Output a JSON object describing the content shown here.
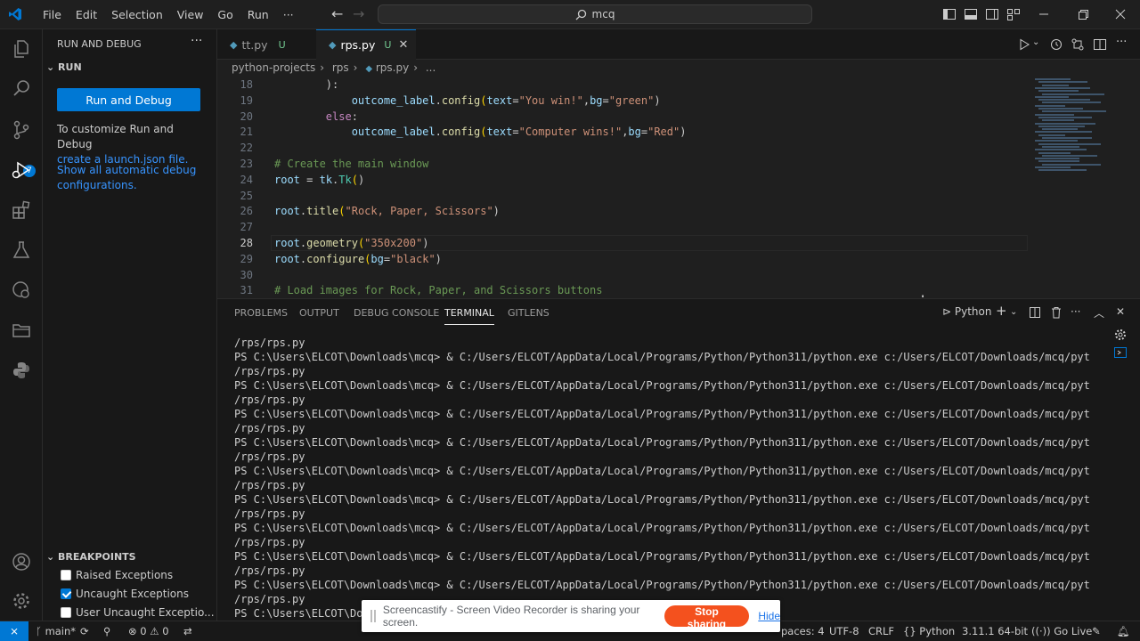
{
  "titlebar": {
    "menu": [
      "File",
      "Edit",
      "Selection",
      "View",
      "Go",
      "Run"
    ],
    "more": "···",
    "search": "mcq"
  },
  "sidebar": {
    "header": "RUN AND DEBUG",
    "section": "RUN",
    "run_button": "Run and Debug",
    "customize_text": "To customize Run and Debug",
    "customize_link": "create a launch.json file.",
    "show_link_1": "Show all automatic debug",
    "show_link_2": "configurations.",
    "breakpoints": {
      "header": "BREAKPOINTS",
      "items": [
        {
          "label": "Raised Exceptions",
          "checked": false
        },
        {
          "label": "Uncaught Exceptions",
          "checked": true
        },
        {
          "label": "User Uncaught Exceptio...",
          "checked": false
        }
      ]
    }
  },
  "tabs": [
    {
      "label": "tt.py",
      "status": "U"
    },
    {
      "label": "rps.py",
      "status": "U",
      "active": true
    }
  ],
  "breadcrumb": [
    "python-projects",
    "rps",
    "rps.py",
    "..."
  ],
  "code": {
    "lines": [
      {
        "n": "18",
        "text": "        ):"
      },
      {
        "n": "19",
        "text": "            outcome_label.config(text=\"You win!\",bg=\"green\")"
      },
      {
        "n": "20",
        "text": "        else:"
      },
      {
        "n": "21",
        "text": "            outcome_label.config(text=\"Computer wins!\",bg=\"Red\")"
      },
      {
        "n": "22",
        "text": ""
      },
      {
        "n": "23",
        "text": "# Create the main window"
      },
      {
        "n": "24",
        "text": "root = tk.Tk()"
      },
      {
        "n": "25",
        "text": ""
      },
      {
        "n": "26",
        "text": "root.title(\"Rock, Paper, Scissors\")"
      },
      {
        "n": "27",
        "text": ""
      },
      {
        "n": "28",
        "text": "root.geometry(\"350x200\")"
      },
      {
        "n": "29",
        "text": "root.configure(bg=\"black\")"
      },
      {
        "n": "30",
        "text": ""
      },
      {
        "n": "31",
        "text": "# Load images for Rock, Paper, and Scissors buttons"
      }
    ]
  },
  "panel": {
    "tabs": [
      "PROBLEMS",
      "OUTPUT",
      "DEBUG CONSOLE",
      "TERMINAL",
      "GITLENS"
    ],
    "active_tab": "TERMINAL",
    "shell": "Python",
    "terminal_lines": [
      "/rps/rps.py",
      "PS C:\\Users\\ELCOT\\Downloads\\mcq> & C:/Users/ELCOT/AppData/Local/Programs/Python/Python311/python.exe c:/Users/ELCOT/Downloads/mcq/python-projects",
      "/rps/rps.py",
      "PS C:\\Users\\ELCOT\\Downloads\\mcq> & C:/Users/ELCOT/AppData/Local/Programs/Python/Python311/python.exe c:/Users/ELCOT/Downloads/mcq/python-projects",
      "/rps/rps.py",
      "PS C:\\Users\\ELCOT\\Downloads\\mcq> & C:/Users/ELCOT/AppData/Local/Programs/Python/Python311/python.exe c:/Users/ELCOT/Downloads/mcq/python-projects",
      "/rps/rps.py",
      "PS C:\\Users\\ELCOT\\Downloads\\mcq> & C:/Users/ELCOT/AppData/Local/Programs/Python/Python311/python.exe c:/Users/ELCOT/Downloads/mcq/python-projects",
      "/rps/rps.py",
      "PS C:\\Users\\ELCOT\\Downloads\\mcq> & C:/Users/ELCOT/AppData/Local/Programs/Python/Python311/python.exe c:/Users/ELCOT/Downloads/mcq/python-projects",
      "/rps/rps.py",
      "PS C:\\Users\\ELCOT\\Downloads\\mcq> & C:/Users/ELCOT/AppData/Local/Programs/Python/Python311/python.exe c:/Users/ELCOT/Downloads/mcq/python-projects",
      "/rps/rps.py",
      "PS C:\\Users\\ELCOT\\Downloads\\mcq> & C:/Users/ELCOT/AppData/Local/Programs/Python/Python311/python.exe c:/Users/ELCOT/Downloads/mcq/python-projects",
      "/rps/rps.py",
      "PS C:\\Users\\ELCOT\\Downloads\\mcq> & C:/Users/ELCOT/AppData/Local/Programs/Python/Python311/python.exe c:/Users/ELCOT/Downloads/mcq/python-projects",
      "/rps/rps.py",
      "PS C:\\Users\\ELCOT\\Downloads\\mcq> & C:/Users/ELCOT/AppData/Local/Programs/Python/Python311/python.exe c:/Users/ELCOT/Downloads/mcq/python-projects",
      "/rps/rps.py",
      "PS C:\\Users\\ELCOT\\Downl"
    ]
  },
  "statusbar": {
    "branch": "main*",
    "errors": "0",
    "warnings": "0",
    "spaces": "paces: 4",
    "encoding": "UTF-8",
    "eol": "CRLF",
    "language": "Python",
    "interpreter": "3.11.1 64-bit",
    "golive": "Go Live"
  },
  "banner": {
    "message": "Screencastify - Screen Video Recorder is sharing your screen.",
    "stop": "Stop sharing",
    "hide": "Hide"
  },
  "colors": {
    "accent": "#0078d4",
    "stop_button": "#f4511e"
  }
}
